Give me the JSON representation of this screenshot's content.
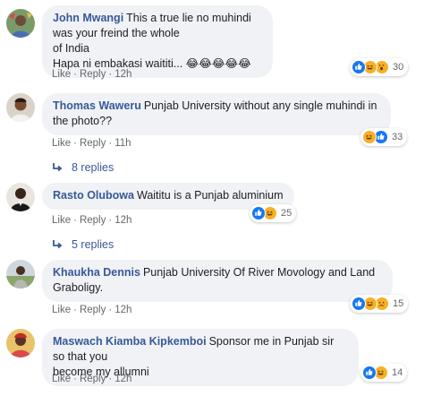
{
  "comments": [
    {
      "author": "John Mwangi",
      "lines": [
        "This a true lie no muhindi was your freind the whole",
        "of India",
        "Hapa ni embakasi waititi... 😂😂😂😂😂"
      ],
      "like": "Like",
      "reply": "Reply",
      "time": "12h",
      "reactions": [
        "like",
        "haha",
        "wow"
      ],
      "reaction_count": "30"
    },
    {
      "author": "Thomas Waweru",
      "lines": [
        "Punjab University without any single muhindi in",
        "the photo??"
      ],
      "like": "Like",
      "reply": "Reply",
      "time": "11h",
      "reactions": [
        "haha",
        "like"
      ],
      "reaction_count": "33",
      "replies": "8 replies"
    },
    {
      "author": "Rasto Olubowa",
      "lines": [
        "Waititu is a Punjab aluminium"
      ],
      "like": "Like",
      "reply": "Reply",
      "time": "12h",
      "reactions": [
        "like",
        "haha"
      ],
      "reaction_count": "25",
      "replies": "5 replies"
    },
    {
      "author": "Khaukha Dennis",
      "lines": [
        "Punjab University Of River Movology and Land",
        "Graboligy."
      ],
      "like": "Like",
      "reply": "Reply",
      "time": "12h",
      "reactions": [
        "like",
        "haha",
        "sad"
      ],
      "reaction_count": "15"
    },
    {
      "author": "Maswach Kiamba Kipkemboi",
      "lines": [
        "Sponsor me in Punjab sir so that you",
        "become my allumni"
      ],
      "like": "Like",
      "reply": "Reply",
      "time": "12h",
      "reactions": [
        "like",
        "haha"
      ],
      "reaction_count": "14"
    }
  ],
  "colors": {
    "author": "#385898",
    "bubble": "#f0f2f5",
    "meta": "#65676b",
    "like": "#1877f2",
    "haha": "#f7b125"
  }
}
